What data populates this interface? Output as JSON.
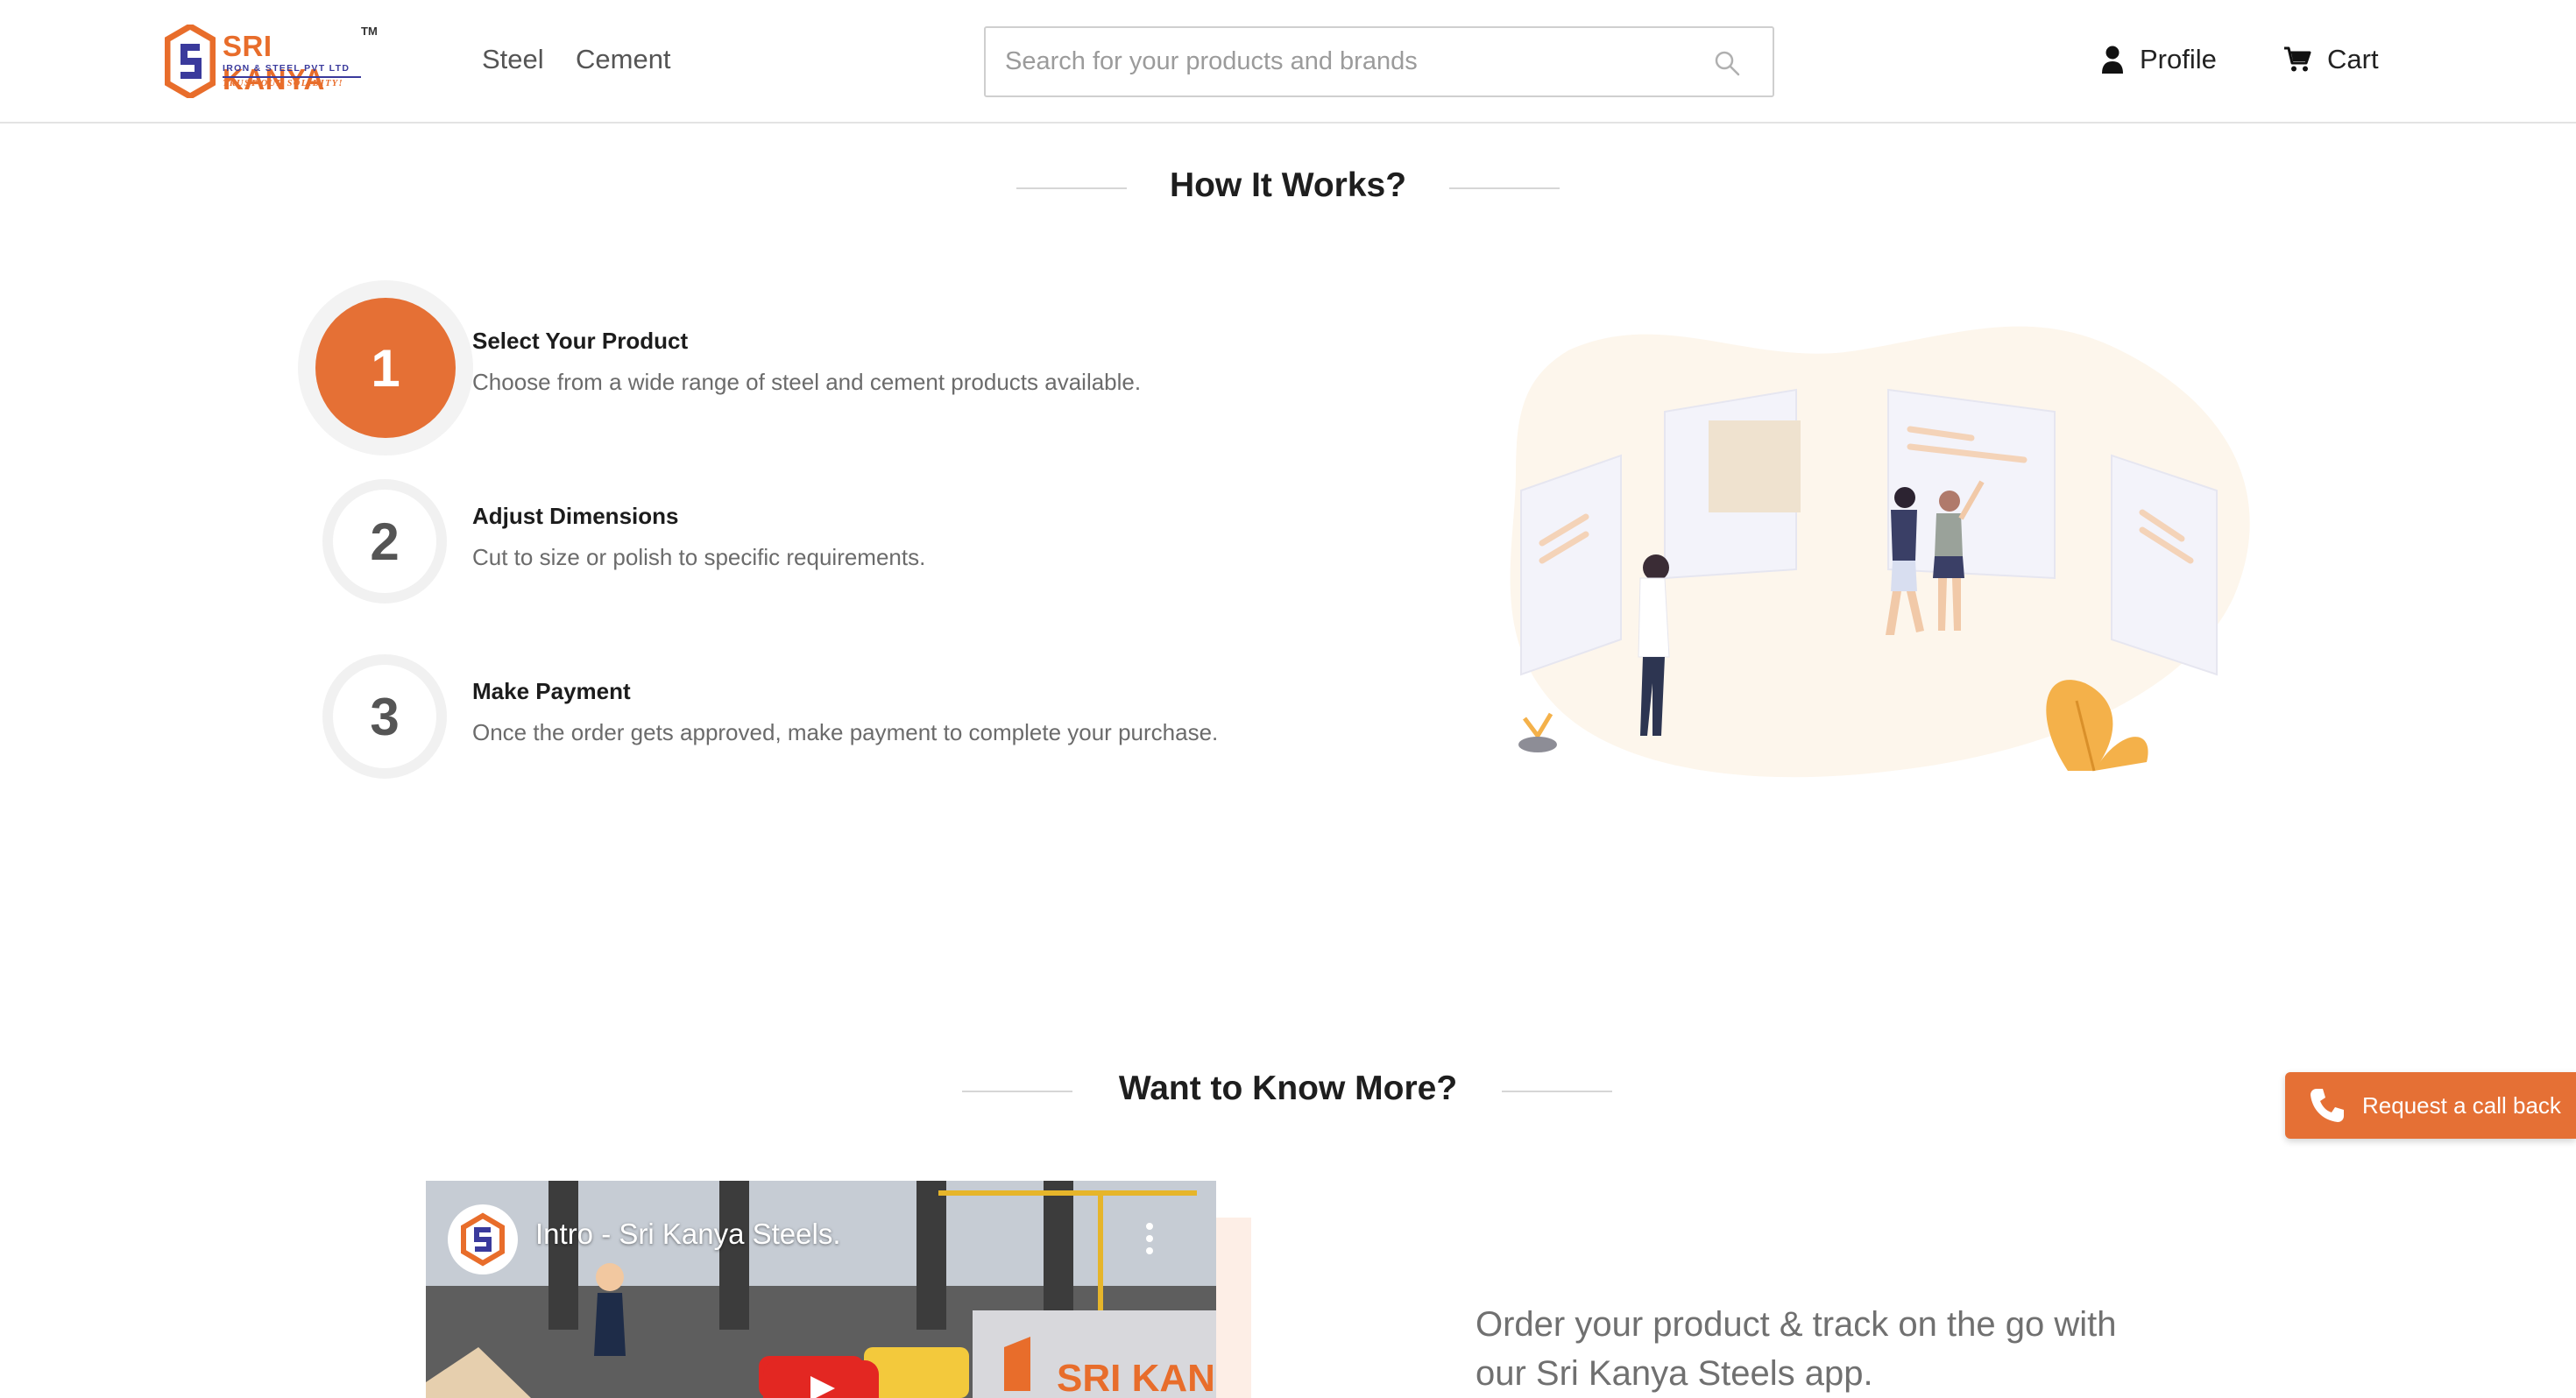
{
  "header": {
    "logo": {
      "name": "SRI KANYA",
      "trademark": "TM",
      "subtitle": "IRON & STEEL PVT LTD",
      "tagline": "TRUST OUR SOLIDITY!"
    },
    "nav": [
      {
        "label": "Steel"
      },
      {
        "label": "Cement"
      }
    ],
    "search": {
      "placeholder": "Search for your products and brands",
      "value": "",
      "icon": "search-icon"
    },
    "profile_label": "Profile",
    "cart_label": "Cart"
  },
  "how_it_works": {
    "title": "How It Works?",
    "steps": [
      {
        "number": "1",
        "title": "Select Your Product",
        "description": "Choose from a wide range of steel and cement products available.",
        "active": true
      },
      {
        "number": "2",
        "title": "Adjust Dimensions",
        "description": "Cut to size or polish to specific requirements.",
        "active": false
      },
      {
        "number": "3",
        "title": "Make Payment",
        "description": "Once the order gets approved, make payment to complete your purchase.",
        "active": false
      }
    ]
  },
  "know_more": {
    "title": "Want to Know More?",
    "video": {
      "title": "Intro - Sri Kanya Steels.",
      "sign_text": "SRI KAN"
    },
    "app_text_line1": "Order your product & track on the go with",
    "app_text_line2": "our Sri Kanya Steels app."
  },
  "callback": {
    "label": "Request a call back",
    "icon": "phone-icon"
  },
  "colors": {
    "accent": "#e57035",
    "brand_blue": "#3a3a9c",
    "text_muted": "#6b6b6b"
  }
}
